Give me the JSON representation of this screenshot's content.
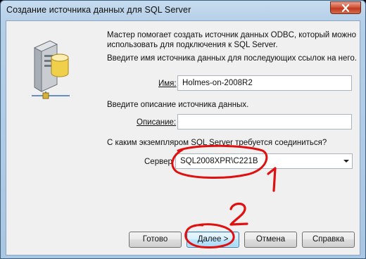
{
  "window": {
    "title": "Создание источника данных для SQL Server"
  },
  "intro": {
    "line1": "Мастер помогает создать источник данных ODBC, который можно",
    "line2": "использовать для подключения к SQL Server.",
    "name_prompt": "Введите имя источника данных для последующих ссылок на него."
  },
  "name_field": {
    "label": "Имя:",
    "value": "Holmes-on-2008R2"
  },
  "description_prompt": "Введите описание источника данных.",
  "description_field": {
    "label": "Описание:",
    "value": ""
  },
  "server_prompt": "С каким экземпляром SQL Server требуется соединиться?",
  "server_field": {
    "label": "Сервер",
    "value": "SQL2008XPR\\C221B"
  },
  "buttons": {
    "finish": "Готово",
    "next": "Далее >",
    "cancel": "Отмена",
    "help": "Справка"
  },
  "annotations": {
    "mark1": "1",
    "mark2": "2",
    "color": "#e01010"
  },
  "icons": [
    "server-database-icon",
    "close-icon",
    "dropdown-arrow-icon"
  ]
}
